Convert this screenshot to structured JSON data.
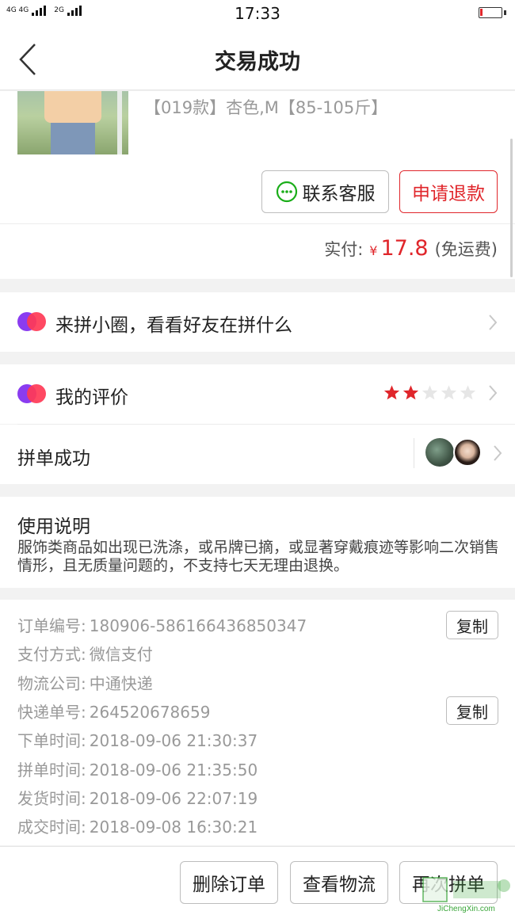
{
  "status_bar": {
    "network_left": "4G 4G",
    "network_right": "2G",
    "time": "17:33",
    "battery_level": 0.12,
    "battery_color": "#e0262b"
  },
  "header": {
    "back_icon": "back-arrow-icon",
    "title": "交易成功"
  },
  "product": {
    "sku": "【019款】杏色,M【85-105斤】",
    "contact_label": "联系客服",
    "refund_label": "申请退款",
    "paid_label": "实付:",
    "currency": "¥",
    "amount": "17.8",
    "shipping_note": "(免运费)"
  },
  "circle_row": {
    "label": "来拼小圈，看看好友在拼什么"
  },
  "review_row": {
    "label": "我的评价",
    "rating": 2,
    "max_rating": 5
  },
  "group_row": {
    "label": "拼单成功"
  },
  "instructions": {
    "title": "使用说明",
    "body": "服饰类商品如出现已洗涤，或吊牌已摘，或显著穿戴痕迹等影响二次销售情形，且无质量问题的，不支持七天无理由退换。"
  },
  "order_info": {
    "copy_label": "复制",
    "rows": [
      {
        "label": "订单编号:",
        "value": "180906-586166436850347"
      },
      {
        "label": "支付方式:",
        "value": "微信支付"
      },
      {
        "label": "物流公司:",
        "value": "中通快递"
      },
      {
        "label": "快递单号:",
        "value": "264520678659"
      },
      {
        "label": "下单时间:",
        "value": "2018-09-06 21:30:37"
      },
      {
        "label": "拼单时间:",
        "value": "2018-09-06 21:35:50"
      },
      {
        "label": "发货时间:",
        "value": "2018-09-06 22:07:19"
      },
      {
        "label": "成交时间:",
        "value": "2018-09-08 16:30:21"
      }
    ]
  },
  "bottom_bar": {
    "delete_label": "删除订单",
    "logistics_label": "查看物流",
    "regroup_label": "再次拼单"
  },
  "watermark": {
    "text": "JiChengXin.com"
  },
  "colors": {
    "accent": "#e0262b",
    "star_on": "#e0262b",
    "star_off": "#e6e6e6",
    "wechat_green": "#1aad19"
  }
}
